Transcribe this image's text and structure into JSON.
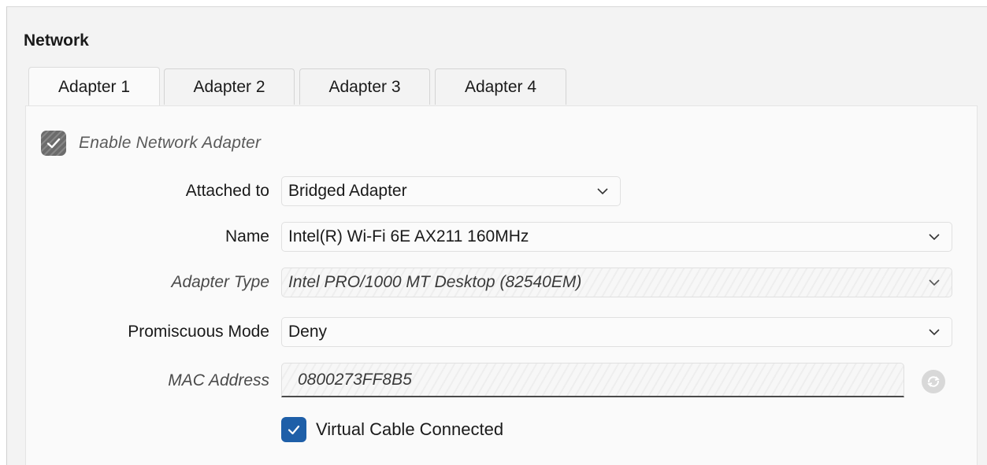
{
  "section": {
    "title": "Network"
  },
  "tabs": [
    {
      "label": "Adapter 1",
      "active": true
    },
    {
      "label": "Adapter 2",
      "active": false
    },
    {
      "label": "Adapter 3",
      "active": false
    },
    {
      "label": "Adapter 4",
      "active": false
    }
  ],
  "enable_adapter": {
    "label": "Enable Network Adapter",
    "checked": true,
    "enabled": false,
    "icon": "check-icon"
  },
  "fields": {
    "attached_to": {
      "label": "Attached to",
      "value": "Bridged Adapter"
    },
    "name": {
      "label": "Name",
      "value": "Intel(R) Wi-Fi 6E AX211 160MHz"
    },
    "adapter_type": {
      "label": "Adapter Type",
      "value": "Intel PRO/1000 MT Desktop (82540EM)",
      "enabled": false
    },
    "promiscuous_mode": {
      "label": "Promiscuous Mode",
      "value": "Deny"
    },
    "mac_address": {
      "label": "MAC Address",
      "value": "0800273FF8B5",
      "enabled": false
    }
  },
  "refresh_button": {
    "icon": "refresh-icon",
    "enabled": false
  },
  "virtual_cable": {
    "label": "Virtual Cable Connected",
    "checked": true,
    "icon": "check-icon"
  },
  "colors": {
    "accent": "#1e5fa8",
    "panel_bg": "#fafafa",
    "frame_bg": "#f3f3f3"
  }
}
